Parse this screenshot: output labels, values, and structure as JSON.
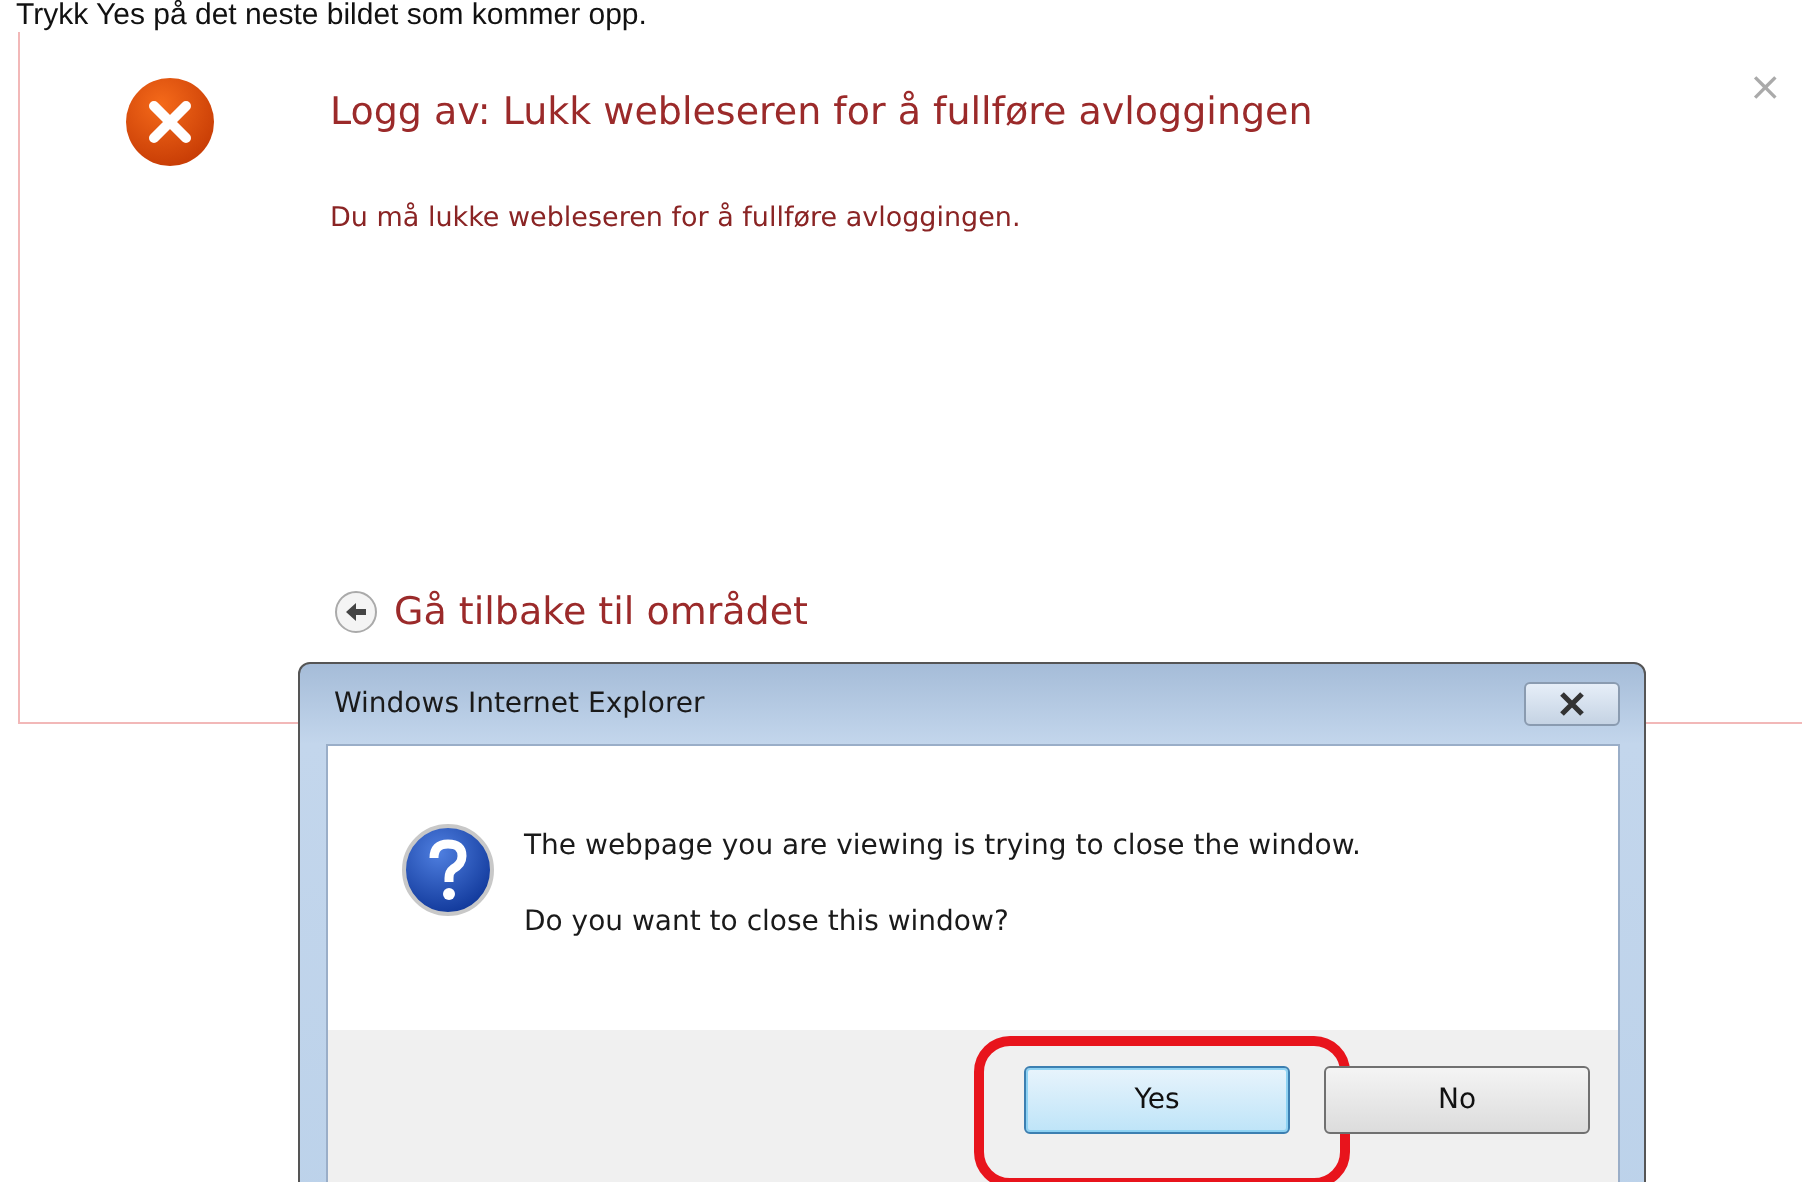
{
  "instruction": "Trykk Yes på det neste bildet som kommer opp.",
  "page": {
    "title": "Logg av: Lukk webleseren for å fullføre avloggingen",
    "message": "Du må lukke webleseren for å fullføre avloggingen.",
    "close_symbol": "×",
    "back_link": "Gå tilbake til området"
  },
  "dialog": {
    "title": "Windows Internet Explorer",
    "lines": [
      "The webpage you are viewing is trying to close the window.",
      "Do you want to close this window?"
    ],
    "buttons": [
      {
        "label": "Yes",
        "selected": true,
        "highlighted": true
      },
      {
        "label": "No",
        "selected": false,
        "highlighted": false
      }
    ]
  }
}
